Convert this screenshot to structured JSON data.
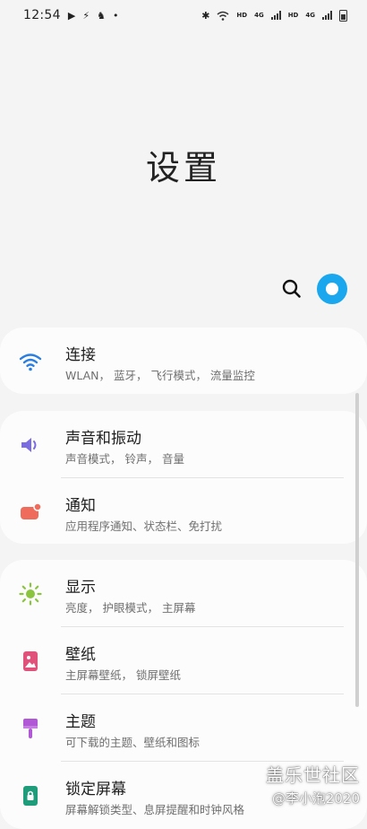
{
  "status_bar": {
    "time": "12:54",
    "hd1": "HD",
    "net1": "4G",
    "hd2": "HD",
    "net2": "4G"
  },
  "header": {
    "title": "设置"
  },
  "groups": [
    {
      "items": [
        {
          "title": "连接",
          "subtitle": "WLAN， 蓝牙， 飞行模式， 流量监控",
          "icon": "wifi-icon",
          "color": "#2a7de1"
        }
      ]
    },
    {
      "items": [
        {
          "title": "声音和振动",
          "subtitle": "声音模式， 铃声， 音量",
          "icon": "speaker-icon",
          "color": "#7b6be0"
        },
        {
          "title": "通知",
          "subtitle": "应用程序通知、状态栏、免打扰",
          "icon": "notification-icon",
          "color": "#ef6b5b"
        }
      ]
    },
    {
      "items": [
        {
          "title": "显示",
          "subtitle": "亮度， 护眼模式， 主屏幕",
          "icon": "brightness-icon",
          "color": "#8bc53f"
        },
        {
          "title": "壁纸",
          "subtitle": "主屏幕壁纸， 锁屏壁纸",
          "icon": "wallpaper-icon",
          "color": "#e0527a"
        },
        {
          "title": "主题",
          "subtitle": "可下载的主题、壁纸和图标",
          "icon": "theme-brush-icon",
          "color": "#b158d6"
        },
        {
          "title": "锁定屏幕",
          "subtitle": "屏幕解锁类型、息屏提醒和时钟风格",
          "icon": "lock-icon",
          "color": "#1f9d7a"
        }
      ]
    }
  ],
  "watermark": {
    "line1": "盖乐世社区",
    "line2": "@李小泡2020"
  }
}
